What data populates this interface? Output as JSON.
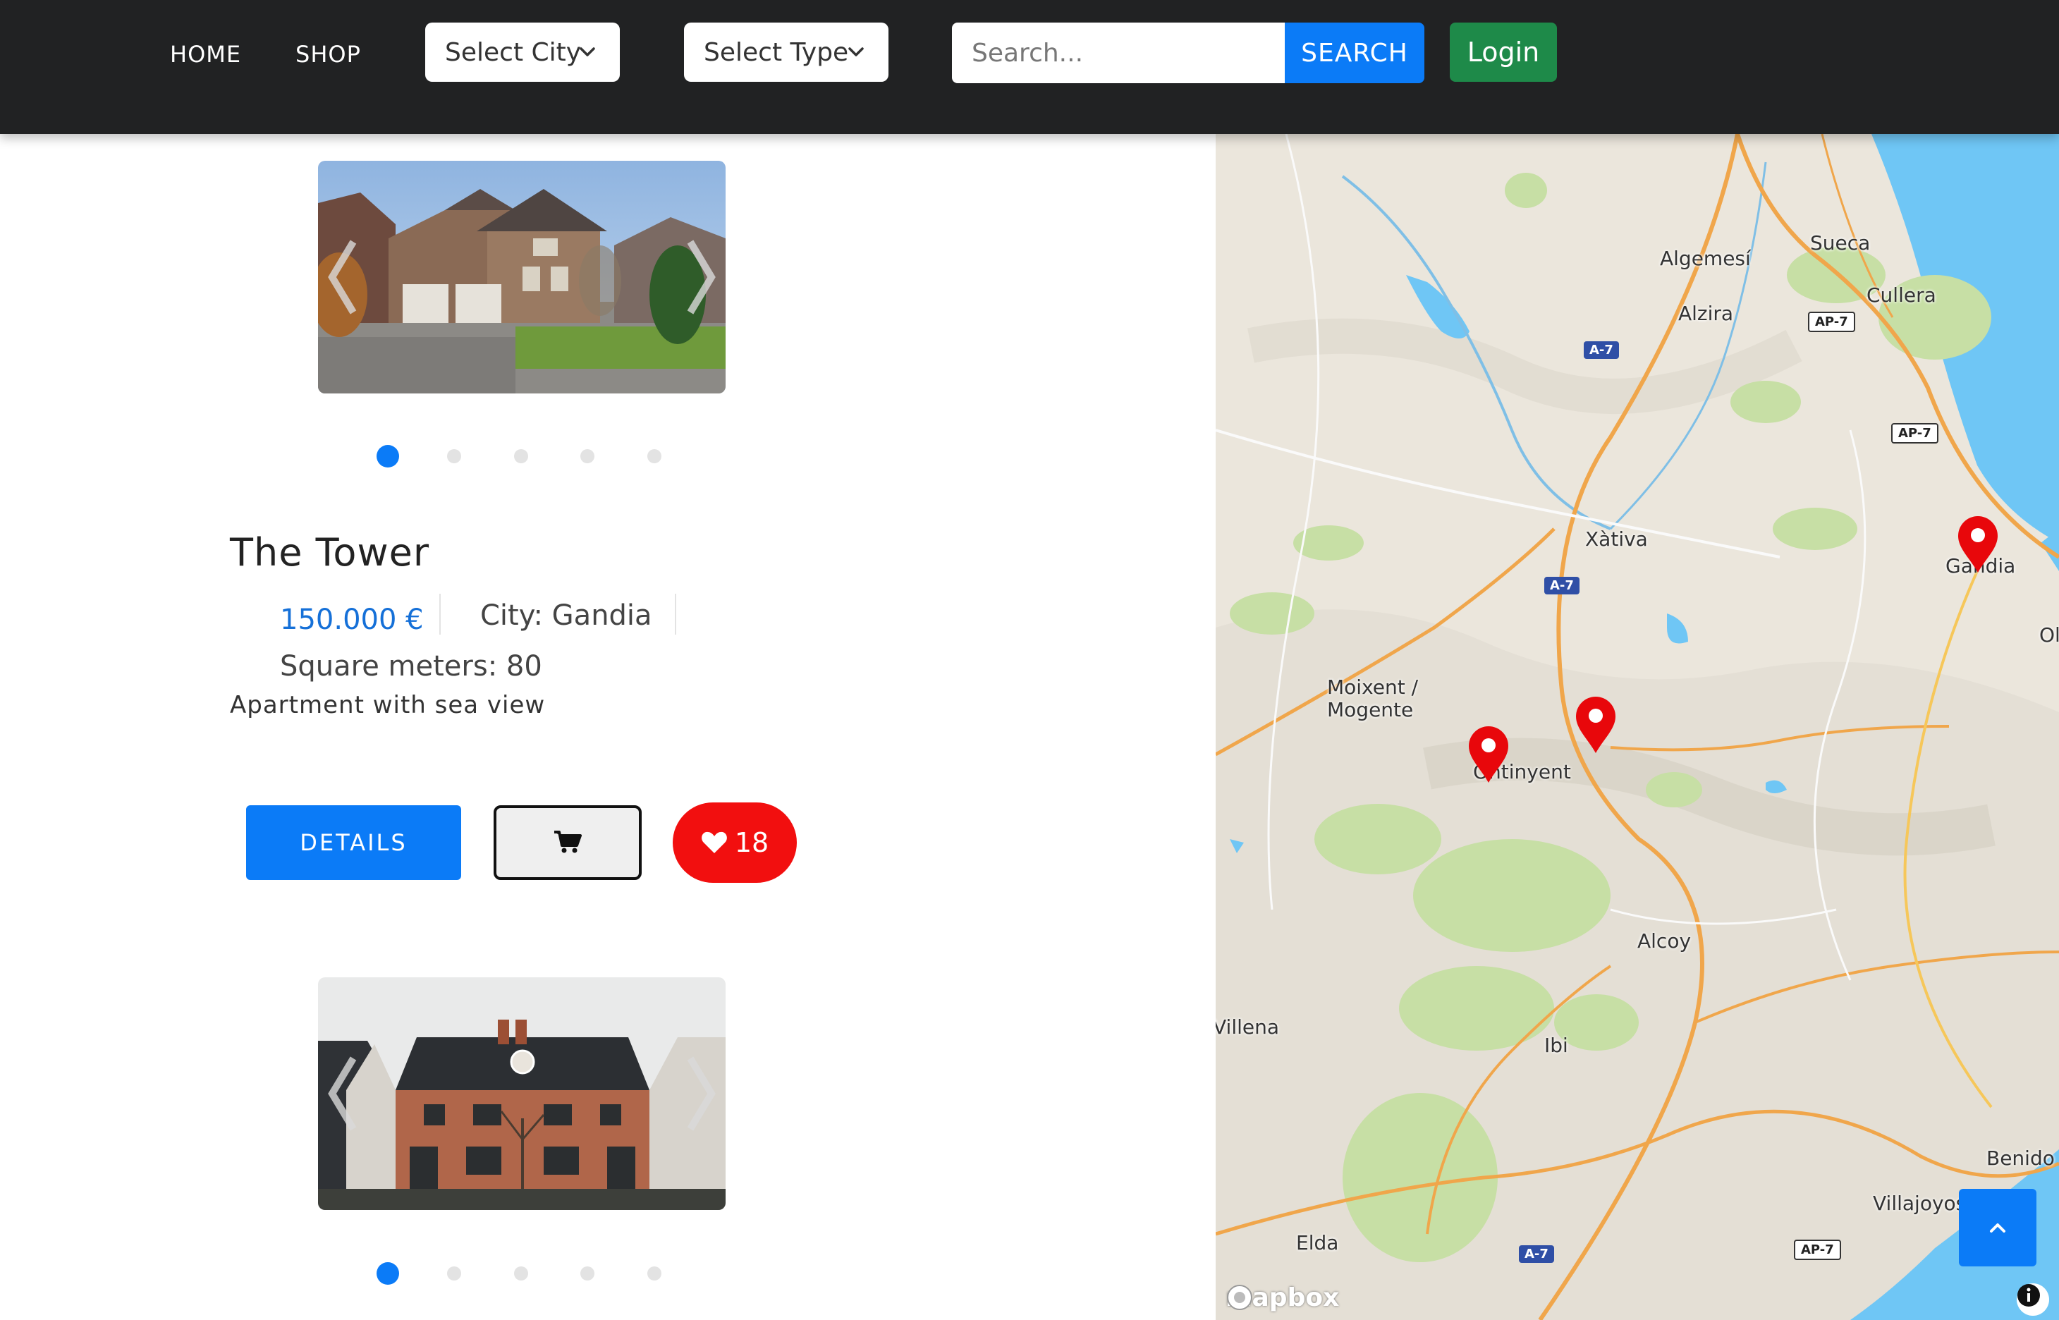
{
  "nav": {
    "home": "HOME",
    "shop": "SHOP",
    "city_select": "Select City",
    "type_select": "Select Type",
    "search_placeholder": "Search...",
    "search_button": "SEARCH",
    "login_button": "Login"
  },
  "listings": [
    {
      "title": "The Tower",
      "price": "150.000 €",
      "city": "City: Gandia",
      "square_meters": "Square meters: 80",
      "description": "Apartment with sea view",
      "details_button": "DETAILS",
      "likes": "18",
      "carousel_slides": 5,
      "active_slide": 1
    },
    {
      "carousel_slides": 5,
      "active_slide": 1
    }
  ],
  "map": {
    "labels": [
      "Algemesí",
      "Sueca",
      "Cullera",
      "Alzira",
      "Xàtiva",
      "Gandia",
      "Oliv",
      "Moixent /",
      "Mogente",
      "Ontinyent",
      "Alcoy",
      "Villena",
      "Ibi",
      "Elda",
      "Villajoyos",
      "Benido"
    ],
    "shields": [
      "A-7",
      "AP-7",
      "AP-7",
      "A-7",
      "A-7",
      "AP-7"
    ],
    "attribution": "mapbox"
  },
  "colors": {
    "navbar": "#212223",
    "primary": "#0b7bf7",
    "login": "#1e8a49",
    "like": "#f20f0f",
    "pin": "#e8070b",
    "water": "#6fc6f5",
    "forest": "#c7dfa5"
  }
}
